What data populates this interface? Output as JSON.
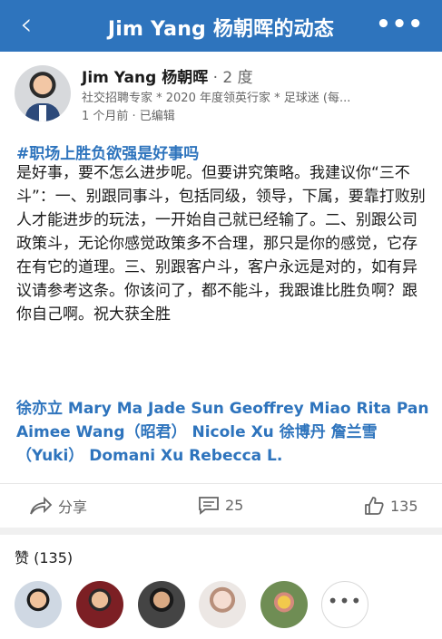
{
  "header": {
    "back_glyph": "‹",
    "title": "Jim Yang 杨朝晖的动态",
    "more_glyph": "•••"
  },
  "post": {
    "author": "Jim Yang 杨朝晖",
    "degree": " · 2 度",
    "headline": "社交招聘专家 * 2020 年度领英行家 * 足球迷 (每...",
    "time": "1 个月前 · 已编辑",
    "hashtag": "#职场上胜负欲强是好事吗",
    "body": "是好事，要不怎么进步呢。但要讲究策略。我建议你“三不斗”：一、别跟同事斗，包括同级，领导，下属，要靠打败别人才能进步的玩法，一开始自己就已经输了。二、别跟公司政策斗，无论你感觉政策多不合理，那只是你的感觉，它存在有它的道理。三、别跟客户斗，客户永远是对的，如有异议请参考这条。你该问了，都不能斗，我跟谁比胜负啊？跟你自己啊。祝大获全胜",
    "mentions": "徐亦立 Mary Ma Jade Sun Geoffrey Miao Rita Pan Aimee Wang（昭君） Nicole Xu 徐博丹 詹兰雪（Yuki） Domani Xu Rebecca L."
  },
  "actions": {
    "share_label": "分享",
    "comment_count": "25",
    "like_count": "135"
  },
  "likes": {
    "label": "赞 (135)",
    "more_glyph": "•••"
  },
  "colors": {
    "brand": "#2e74bd",
    "link": "#2e74bd"
  },
  "icons": [
    "back-chevron-icon",
    "more-icon",
    "share-icon",
    "comment-icon",
    "like-icon"
  ]
}
